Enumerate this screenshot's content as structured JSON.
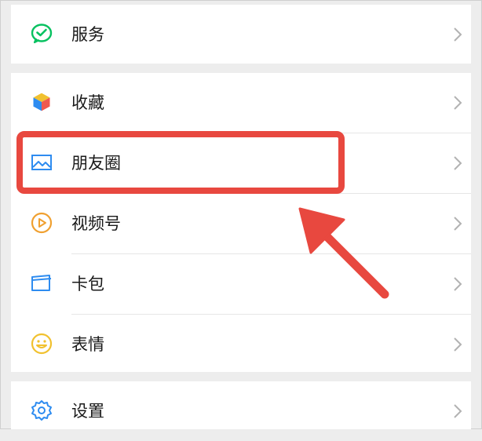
{
  "menu": {
    "service": {
      "label": "服务",
      "icon": "wechat-pay-icon"
    },
    "favorites": {
      "label": "收藏",
      "icon": "cube-icon"
    },
    "moments": {
      "label": "朋友圈",
      "icon": "image-icon"
    },
    "channels": {
      "label": "视频号",
      "icon": "play-circle-icon"
    },
    "cards": {
      "label": "卡包",
      "icon": "wallet-icon"
    },
    "stickers": {
      "label": "表情",
      "icon": "smile-icon"
    },
    "settings": {
      "label": "设置",
      "icon": "gear-icon"
    }
  },
  "annotation": {
    "color": "#e8483f",
    "highlighted": "moments"
  },
  "colors": {
    "background": "#ededed",
    "panel": "#ffffff",
    "accent_green": "#07c160"
  }
}
